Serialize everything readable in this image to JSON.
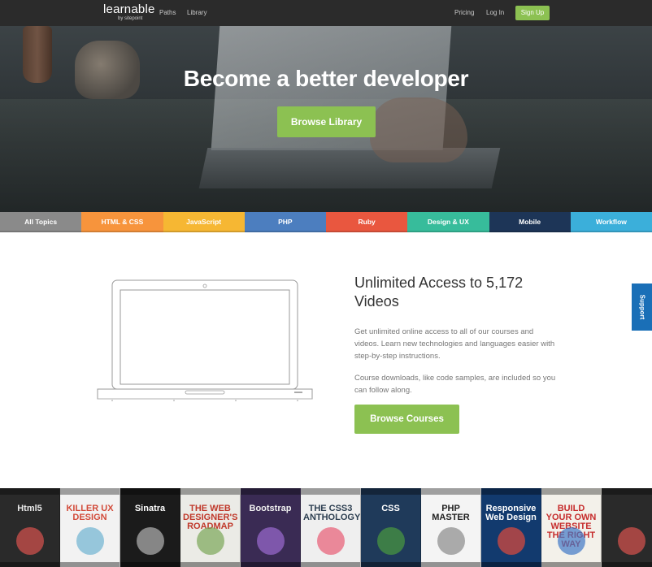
{
  "nav": {
    "logo": "learnable",
    "logo_sub": "by sitepoint",
    "links": [
      "Paths",
      "Library"
    ],
    "right_links": [
      "Pricing",
      "Log In"
    ],
    "signup": "Sign Up"
  },
  "hero": {
    "title": "Become a better developer",
    "button": "Browse Library"
  },
  "topics": [
    {
      "label": "All Topics",
      "color": "#8a8a8a"
    },
    {
      "label": "HTML & CSS",
      "color": "#f7943c"
    },
    {
      "label": "JavaScript",
      "color": "#f6b733"
    },
    {
      "label": "PHP",
      "color": "#4c7ebf"
    },
    {
      "label": "Ruby",
      "color": "#e9573f"
    },
    {
      "label": "Design & UX",
      "color": "#37bc9b"
    },
    {
      "label": "Mobile",
      "color": "#1d3557"
    },
    {
      "label": "Workflow",
      "color": "#3bafda"
    }
  ],
  "main": {
    "title": "Unlimited Access to 5,172 Videos",
    "paragraph1": "Get unlimited online access to all of our courses and videos. Learn new technologies and languages easier with step-by-step instructions.",
    "paragraph2": "Course downloads, like code samples, are included so you can follow along.",
    "button": "Browse Courses"
  },
  "support": "Support",
  "books": [
    {
      "title": "Html5",
      "bg": "#2a2a2a",
      "fg": "#e8e8e8",
      "accent": "#d9534f"
    },
    {
      "title": "KILLER UX DESIGN",
      "bg": "#f2f2f2",
      "fg": "#d24b3a",
      "accent": "#6fb3d2"
    },
    {
      "title": "Sinatra",
      "bg": "#1b1b1b",
      "fg": "#ffffff",
      "accent": "#b4b4b4"
    },
    {
      "title": "THE WEB DESIGNER'S ROADMAP",
      "bg": "#ebebe6",
      "fg": "#c0392b",
      "accent": "#7aa657"
    },
    {
      "title": "Bootstrap",
      "bg": "#3a2b54",
      "fg": "#f0f0f0",
      "accent": "#9b6bd0"
    },
    {
      "title": "THE CSS3 ANTHOLOGY",
      "bg": "#efefef",
      "fg": "#2c3e50",
      "accent": "#e85d75"
    },
    {
      "title": "CSS",
      "bg": "#1f3a5a",
      "fg": "#ffffff",
      "accent": "#4a9a3f"
    },
    {
      "title": "PHP MASTER",
      "bg": "#f4f4f4",
      "fg": "#222222",
      "accent": "#8a8a8a"
    },
    {
      "title": "Responsive Web Design",
      "bg": "#123a6e",
      "fg": "#ffffff",
      "accent": "#e04a3a"
    },
    {
      "title": "BUILD YOUR OWN WEBSITE THE RIGHT WAY",
      "bg": "#f3f1ea",
      "fg": "#c62d2d",
      "accent": "#3f78c6"
    },
    {
      "title": "",
      "bg": "#2a2a2a",
      "fg": "#e8e8e8",
      "accent": "#d9534f"
    }
  ]
}
